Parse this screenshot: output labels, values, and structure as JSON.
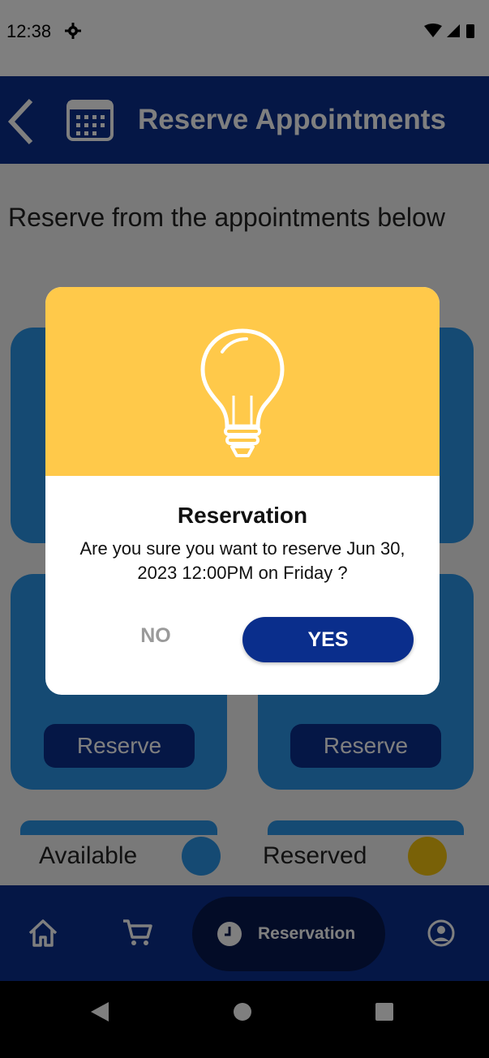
{
  "status_bar": {
    "time": "12:38"
  },
  "header": {
    "title": "Reserve Appointments"
  },
  "main": {
    "subtitle": "Reserve from the appointments below",
    "cards": [
      {
        "button_label": "Reserve"
      },
      {
        "button_label": "Reserve"
      }
    ],
    "legend": {
      "available": "Available",
      "reserved": "Reserved"
    }
  },
  "bottom_nav": {
    "active_label": "Reservation"
  },
  "dialog": {
    "title": "Reservation",
    "message": "Are you sure you want to reserve Jun 30, 2023 12:00PM on Friday ?",
    "no_label": "NO",
    "yes_label": "YES"
  },
  "colors": {
    "primary": "#0a2e8c",
    "card_blue": "#2b95e6",
    "accent_yellow": "#ffc94a",
    "available_dot": "#2b95e6",
    "reserved_dot": "#f2c30f"
  }
}
